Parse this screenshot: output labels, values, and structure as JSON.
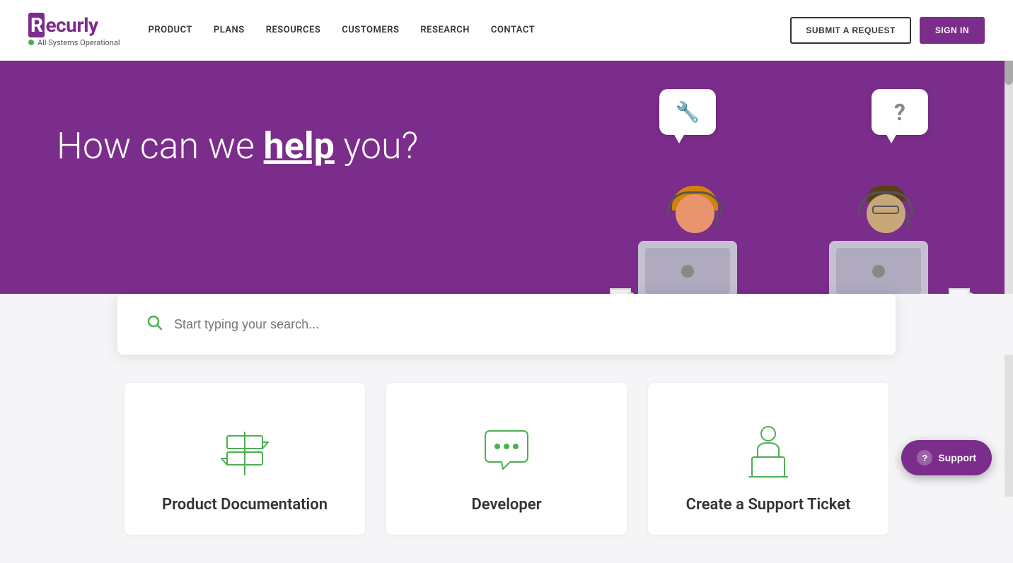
{
  "navbar": {
    "logo": "Recurly",
    "status_text": "All Systems Operational",
    "links": [
      {
        "label": "PRODUCT",
        "id": "product"
      },
      {
        "label": "PLANS",
        "id": "plans"
      },
      {
        "label": "RESOURCES",
        "id": "resources"
      },
      {
        "label": "CUSTOMERS",
        "id": "customers"
      },
      {
        "label": "RESEARCH",
        "id": "research"
      },
      {
        "label": "CONTACT",
        "id": "contact"
      }
    ],
    "submit_label": "SUBMIT A REQUEST",
    "signin_label": "SIGN IN"
  },
  "hero": {
    "heading_prefix": "How can we ",
    "heading_highlight": "help",
    "heading_suffix": " you?"
  },
  "search": {
    "placeholder": "Start typing your search..."
  },
  "cards": [
    {
      "id": "product-docs",
      "title": "Product Documentation",
      "icon": "signpost"
    },
    {
      "id": "developer",
      "title": "Developer",
      "icon": "chat"
    },
    {
      "id": "support-ticket",
      "title": "Create a Support Ticket",
      "icon": "laptop-person"
    }
  ],
  "support_fab": {
    "label": "Support",
    "icon": "support-icon"
  }
}
